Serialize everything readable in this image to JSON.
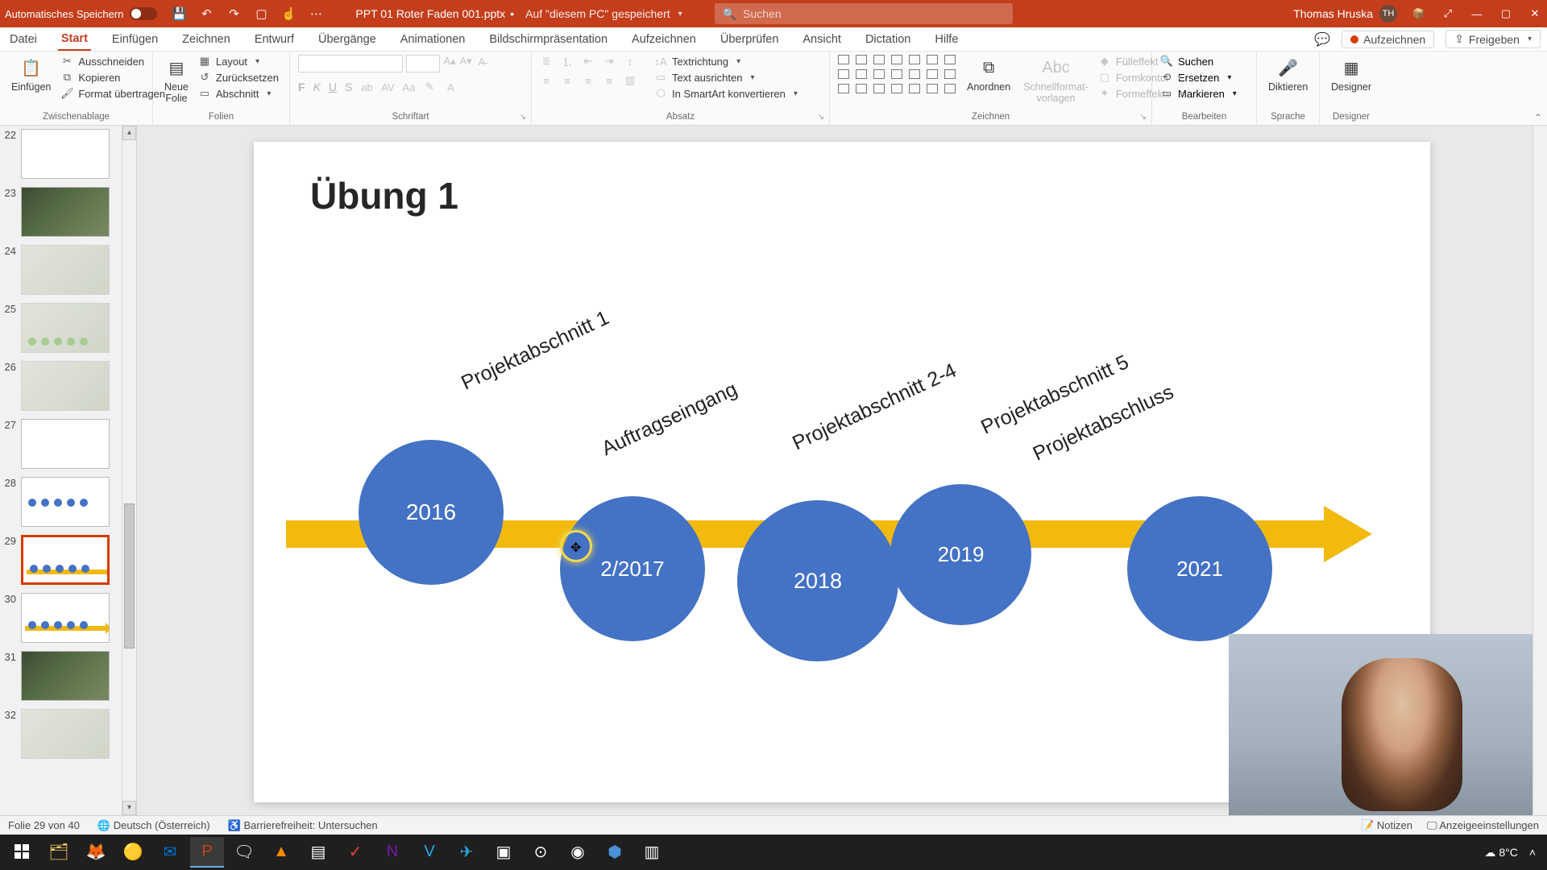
{
  "titlebar": {
    "autosave_label": "Automatisches Speichern",
    "doc_name": "PPT 01 Roter Faden 001.pptx",
    "saved_location": "Auf \"diesem PC\" gespeichert",
    "search_placeholder": "Suchen",
    "user_name": "Thomas Hruska",
    "user_initials": "TH"
  },
  "tabs": {
    "items": [
      "Datei",
      "Start",
      "Einfügen",
      "Zeichnen",
      "Entwurf",
      "Übergänge",
      "Animationen",
      "Bildschirmpräsentation",
      "Aufzeichnen",
      "Überprüfen",
      "Ansicht",
      "Dictation",
      "Hilfe"
    ],
    "active_index": 1,
    "record_label": "Aufzeichnen",
    "share_label": "Freigeben"
  },
  "ribbon": {
    "clipboard": {
      "paste": "Einfügen",
      "cut": "Ausschneiden",
      "copy": "Kopieren",
      "format_painter": "Format übertragen",
      "group": "Zwischenablage"
    },
    "slides": {
      "new_slide": "Neue\nFolie",
      "layout": "Layout",
      "reset": "Zurücksetzen",
      "section": "Abschnitt",
      "group": "Folien"
    },
    "font": {
      "bold": "F",
      "italic": "K",
      "underline": "U",
      "strike": "S",
      "group": "Schriftart"
    },
    "paragraph": {
      "text_direction": "Textrichtung",
      "align_text": "Text ausrichten",
      "smartart": "In SmartArt konvertieren",
      "group": "Absatz"
    },
    "drawing": {
      "arrange": "Anordnen",
      "quick_styles": "Schnellformat-\nvorlagen",
      "shape_fill": "Fülleffekt",
      "shape_outline": "Formkontur",
      "shape_effects": "Formeffekte",
      "group": "Zeichnen"
    },
    "editing": {
      "find": "Suchen",
      "replace": "Ersetzen",
      "select": "Markieren",
      "group": "Bearbeiten"
    },
    "voice": {
      "dictate": "Diktieren",
      "group": "Sprache"
    },
    "designer": {
      "label": "Designer",
      "group": "Designer"
    }
  },
  "thumbs": [
    {
      "num": "22",
      "kind": "blank"
    },
    {
      "num": "23",
      "kind": "photo"
    },
    {
      "num": "24",
      "kind": "faded"
    },
    {
      "num": "25",
      "kind": "greendots"
    },
    {
      "num": "26",
      "kind": "faded"
    },
    {
      "num": "27",
      "kind": "text"
    },
    {
      "num": "28",
      "kind": "dots"
    },
    {
      "num": "29",
      "kind": "arrow_sel"
    },
    {
      "num": "30",
      "kind": "arrow"
    },
    {
      "num": "31",
      "kind": "photo"
    },
    {
      "num": "32",
      "kind": "faded"
    }
  ],
  "slide": {
    "title": "Übung 1",
    "circles": [
      "2016",
      "2/2017",
      "2018",
      "2019",
      "2021"
    ],
    "labels": {
      "a1": "Projektabschnitt 1",
      "a2": "Auftragseingang",
      "a3": "Projektabschnitt 2-4",
      "a4": "Projektabschnitt 5",
      "a5": "Projektabschluss"
    }
  },
  "status": {
    "slide_counter": "Folie 29 von 40",
    "language": "Deutsch (Österreich)",
    "accessibility": "Barrierefreiheit: Untersuchen",
    "notes": "Notizen",
    "display_settings": "Anzeigeeinstellungen"
  },
  "taskbar": {
    "temp": "8°C"
  }
}
